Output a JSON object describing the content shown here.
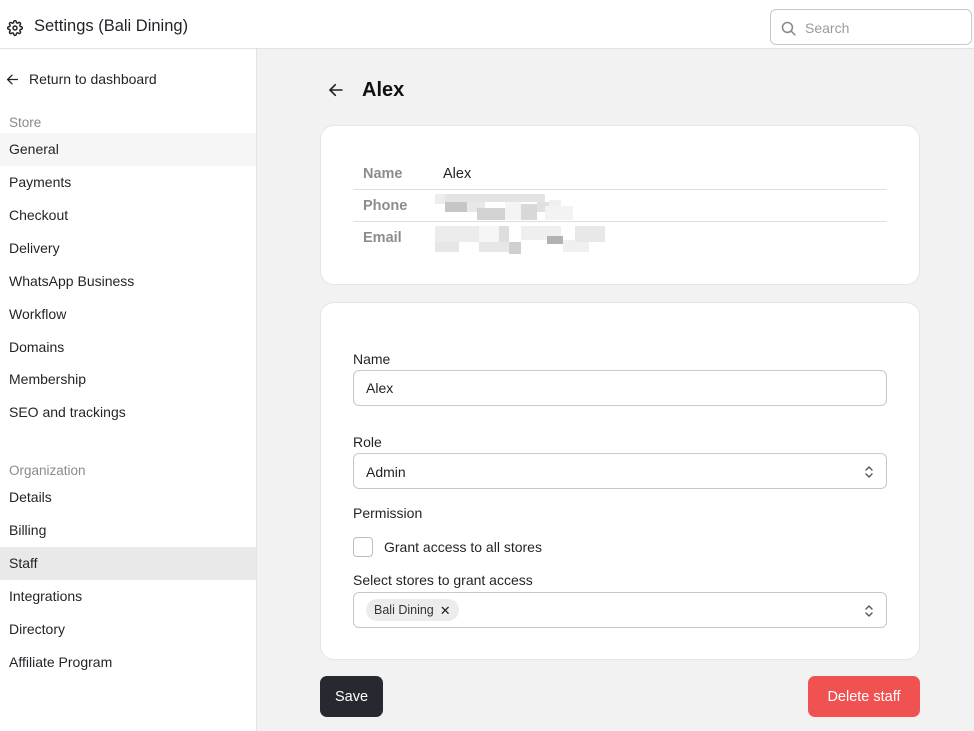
{
  "header": {
    "title": "Settings (Bali Dining)",
    "search_placeholder": "Search"
  },
  "sidebar": {
    "return_label": "Return to dashboard",
    "store_section": "Store",
    "store_items": [
      "General",
      "Payments",
      "Checkout",
      "Delivery",
      "WhatsApp Business",
      "Workflow",
      "Domains",
      "Membership",
      "SEO and trackings"
    ],
    "org_section": "Organization",
    "org_items": [
      "Details",
      "Billing",
      "Staff",
      "Integrations",
      "Directory",
      "Affiliate Program"
    ]
  },
  "page": {
    "title": "Alex"
  },
  "info": {
    "name_label": "Name",
    "name_value": "Alex",
    "phone_label": "Phone",
    "email_label": "Email"
  },
  "form": {
    "name_label": "Name",
    "name_value": "Alex",
    "role_label": "Role",
    "role_value": "Admin",
    "permission_label": "Permission",
    "grant_all_label": "Grant access to all stores",
    "grant_all_checked": false,
    "stores_label": "Select stores to grant access",
    "selected_stores": [
      "Bali Dining"
    ]
  },
  "actions": {
    "save_label": "Save",
    "delete_label": "Delete staff"
  },
  "colors": {
    "save_button": "#262a30",
    "delete_button": "#f05252",
    "main_background": "#f2f2f2"
  }
}
